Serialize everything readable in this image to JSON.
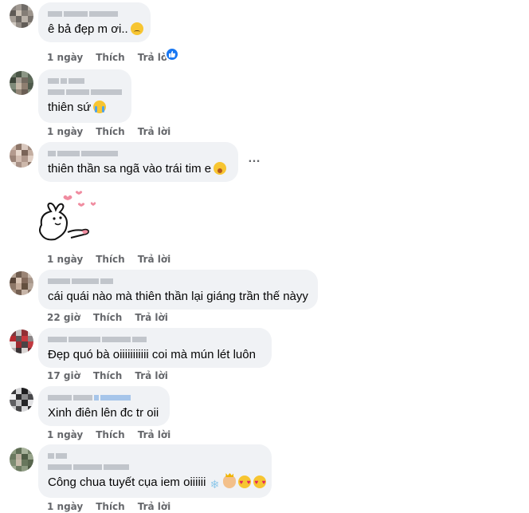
{
  "actions": {
    "like": "Thích",
    "reply": "Trả lời"
  },
  "comments": [
    {
      "text": "ê bả đẹp m ơi..",
      "emoji": "sad",
      "time": "1 ngày"
    },
    {
      "text": "thiên sứ",
      "emoji": "cry",
      "time": "1 ngày"
    },
    {
      "text": "thiên thần sa ngã vào trái tim e",
      "emoji": "shock",
      "time": "1 ngày"
    },
    {
      "text": "cái quái nào mà thiên thần lại giáng trần thế nàyy",
      "time": "22 giờ"
    },
    {
      "text": "Đẹp quó bà oiiiiiiiiiii coi mà mún lét luôn",
      "time": "17 giờ"
    },
    {
      "text": "Xinh điên lên đc tr oii",
      "time": "1 ngày"
    },
    {
      "text": "Công chua tuyết cụa iem oiiiiii",
      "emojis": [
        "snowflake",
        "princess",
        "heart-eyes",
        "heart-eyes"
      ],
      "time": "1 ngày"
    }
  ],
  "more_options": "…",
  "colors": {
    "bubble": "#f0f2f5",
    "meta": "#65676b",
    "like_badge": "#1877f2"
  },
  "icons": [
    "like-reaction-icon",
    "more-options-icon",
    "sticker-bunny-hearts"
  ]
}
